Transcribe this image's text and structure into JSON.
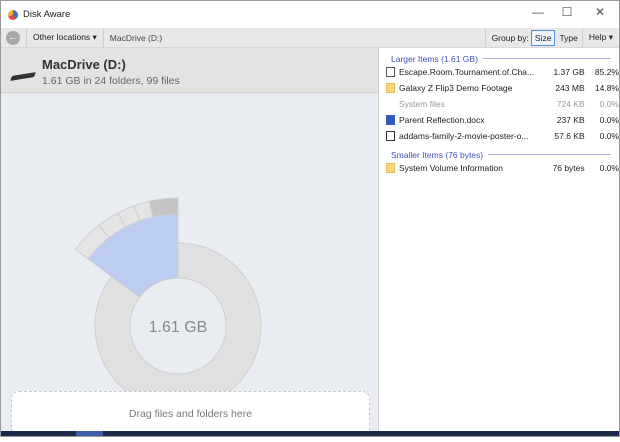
{
  "window": {
    "title": "Disk Aware",
    "minimize": "—",
    "maximize": "☐",
    "close": "✕"
  },
  "toolbar": {
    "back_icon": "arrow-left",
    "location_dropdown": "Other locations ▾",
    "path": "MacDrive (D:)",
    "group_by_label": "Group by:",
    "size": "Size",
    "type": "Type",
    "help": "Help ▾",
    "selected_group": "Size"
  },
  "drive": {
    "name": "MacDrive (D:)",
    "summary": "1.61 GB in 24 folders, 99 files",
    "total": "1.61 GB"
  },
  "chart_data": {
    "type": "pie",
    "inner_label": "1.61 GB",
    "slices": [
      {
        "label": "Escape.Room.Tournament.of.Cha...",
        "percent": 85.2
      },
      {
        "label": "Galaxy Z Flip3 Demo Footage",
        "percent": 14.8,
        "highlighted": true
      }
    ]
  },
  "drop_zone": "Drag files and folders here",
  "larger": {
    "header": "Larger Items (1.61 GB)",
    "items": [
      {
        "name": "Escape.Room.Tournament.of.Cha...",
        "size": "1.37 GB",
        "pct": "85.2%",
        "icon": "video-file-icon"
      },
      {
        "name": "Galaxy Z Flip3 Demo Footage",
        "size": "243 MB",
        "pct": "14.8%",
        "icon": "folder-icon"
      },
      {
        "name": "System files",
        "size": "724 KB",
        "pct": "0.0%",
        "icon": "none"
      },
      {
        "name": "Parent Reflection.docx",
        "size": "237 KB",
        "pct": "0.0%",
        "icon": "word-file-icon"
      },
      {
        "name": "addams-family-2-movie-poster-o...",
        "size": "57.6 KB",
        "pct": "0.0%",
        "icon": "image-file-icon"
      }
    ]
  },
  "smaller": {
    "header": "Smaller Items (76 bytes)",
    "items": [
      {
        "name": "System Volume Information",
        "size": "76 bytes",
        "pct": "0.0%",
        "icon": "folder-icon"
      }
    ]
  },
  "colors": {
    "highlight": "#bccdf1",
    "ring": "#e0e0e0",
    "group_header": "#4052b5"
  }
}
